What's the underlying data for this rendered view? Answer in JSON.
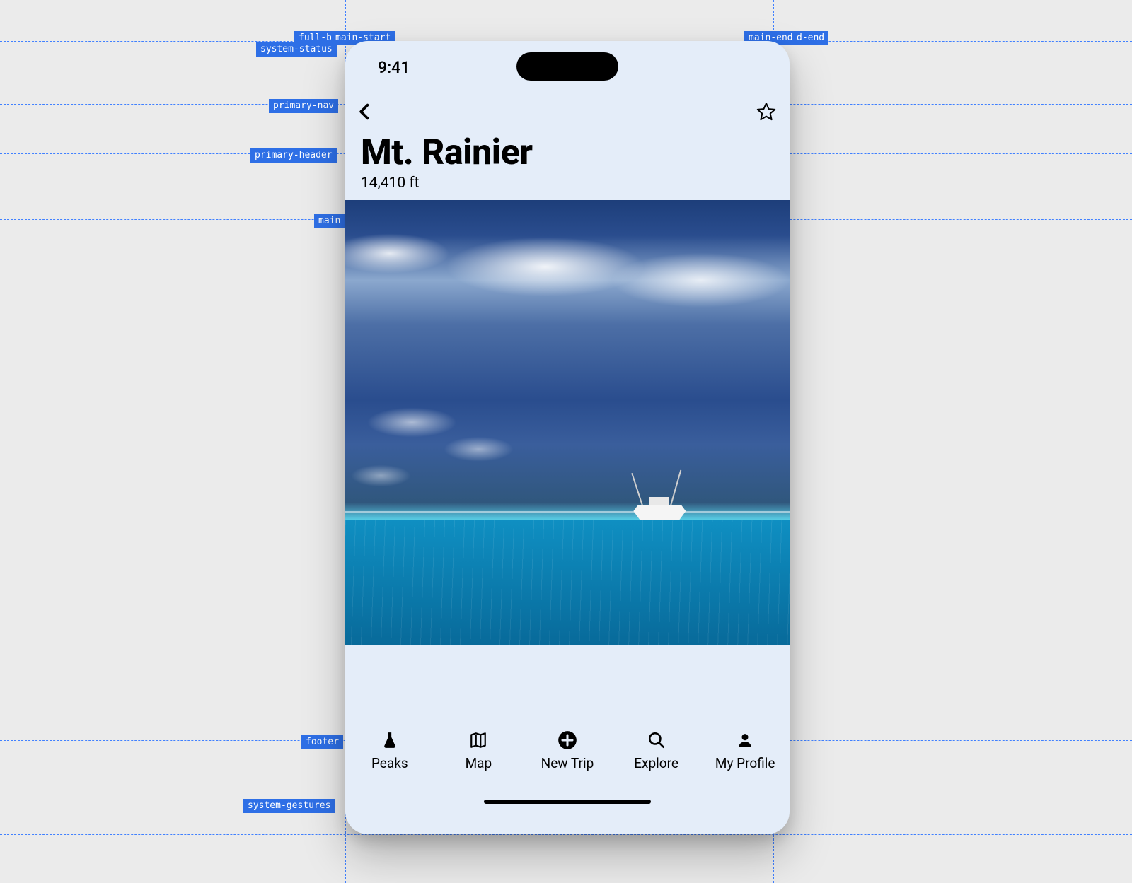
{
  "status": {
    "time": "9:41"
  },
  "header": {
    "title": "Mt. Rainier",
    "subtitle": "14,410 ft"
  },
  "tabs": [
    {
      "label": "Peaks"
    },
    {
      "label": "Map"
    },
    {
      "label": "New Trip"
    },
    {
      "label": "Explore"
    },
    {
      "label": "My Profile"
    }
  ],
  "guides": {
    "full_bleed_start": "full-bleed-start",
    "main_start": "main-start",
    "main_end": "main-end",
    "full_bleed_end": "full-bleed-end",
    "system_status": "system-status",
    "primary_nav": "primary-nav",
    "primary_header": "primary-header",
    "main": "main",
    "footer": "footer",
    "system_gestures": "system-gestures"
  }
}
